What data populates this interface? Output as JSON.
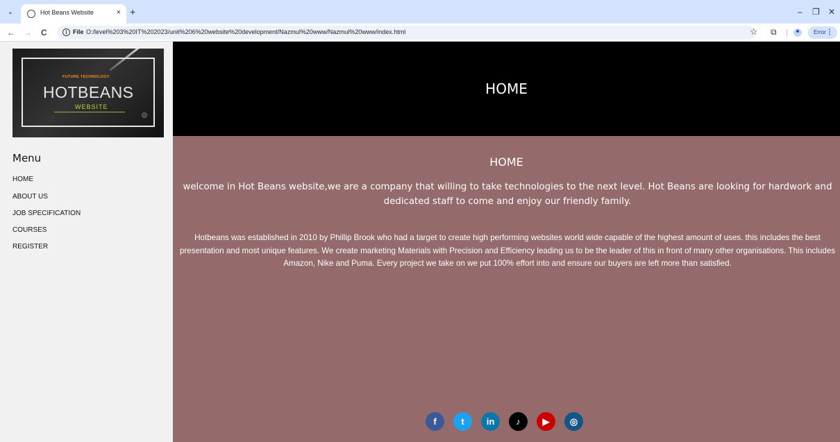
{
  "browser": {
    "tab_title": "Hot Beans Website",
    "tab_close": "×",
    "new_tab": "+",
    "tab_menu": "⌄",
    "file_label": "File",
    "url": "O:/level%203%20IT%202023/unit%206%20website%20development/Nazmul%20www/Nazmul%20www/index.html",
    "error_label": "Error",
    "back": "←",
    "forward": "→",
    "reload": "C",
    "minimize": "–",
    "restore": "❐",
    "close": "✕",
    "star": "☆",
    "extensions": "⧉"
  },
  "logo": {
    "tagline": "FUTURE TECHNOLOGY",
    "name": "HOTBEANS",
    "sub": "WEBSITE"
  },
  "sidebar": {
    "heading": "Menu",
    "items": [
      {
        "label": "HOME"
      },
      {
        "label": "ABOUT US"
      },
      {
        "label": "JOB SPECIFICATION"
      },
      {
        "label": "COURSES"
      },
      {
        "label": "REGISTER"
      }
    ]
  },
  "header": {
    "title": "HOME"
  },
  "main": {
    "title": "HOME",
    "welcome": "welcome in Hot Beans website,we are a company that willing to take technologies to the next level. Hot Beans are looking for hardwork and dedicated staff to come and enjoy our friendly family.",
    "about": "Hotbeans was established in 2010 by Phillip Brook who had a target to create high performing websites world wide capable of the highest amount of uses. this includes the best presentation and most unique features. We create marketing Materials with Precision and Efficiency leading us to be the leader of this in front of many other organisations. This includes Amazon, Nike and Puma. Every project we take on we put 100% effort into and ensure our buyers are left more than satisfied."
  },
  "socials": [
    {
      "name": "facebook-icon",
      "glyph": "f",
      "color": "#3b5998"
    },
    {
      "name": "twitter-icon",
      "glyph": "t",
      "color": "#1da1f2"
    },
    {
      "name": "linkedin-icon",
      "glyph": "in",
      "color": "#0e76a8"
    },
    {
      "name": "tiktok-icon",
      "glyph": "♪",
      "color": "#000000"
    },
    {
      "name": "youtube-icon",
      "glyph": "▶",
      "color": "#cc0000"
    },
    {
      "name": "instagram-icon",
      "glyph": "◎",
      "color": "#125688"
    }
  ]
}
